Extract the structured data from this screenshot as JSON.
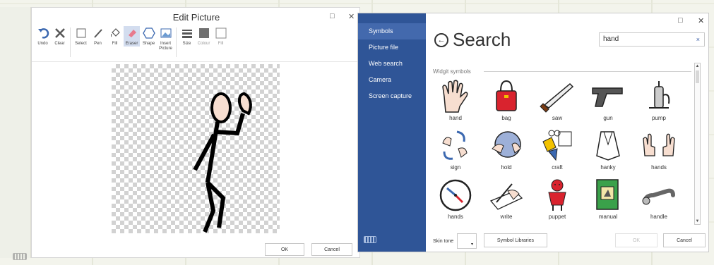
{
  "edit_picture": {
    "title": "Edit Picture",
    "window_buttons": {
      "restore": "□",
      "close": "✕"
    },
    "tools": [
      {
        "label": "Undo",
        "icon": "undo-icon"
      },
      {
        "label": "Clear",
        "icon": "clear-icon"
      },
      {
        "label": "Select",
        "icon": "select-icon"
      },
      {
        "label": "Pen",
        "icon": "pen-icon"
      },
      {
        "label": "Fill",
        "icon": "fill-icon"
      },
      {
        "label": "Eraser",
        "icon": "eraser-icon"
      },
      {
        "label": "Shape",
        "icon": "shape-icon"
      },
      {
        "label": "Insert Picture",
        "icon": "insert-picture-icon"
      },
      {
        "label": "Size",
        "icon": "size-icon"
      },
      {
        "label": "Colour",
        "icon": "colour-icon"
      },
      {
        "label": "Fill",
        "icon": "fill-swatch-icon"
      }
    ],
    "ok_label": "OK",
    "cancel_label": "Cancel"
  },
  "search_panel": {
    "nav": [
      "Symbols",
      "Picture file",
      "Web search",
      "Camera",
      "Screen capture"
    ],
    "active_nav": "Symbols",
    "title": "Search",
    "window_buttons": {
      "restore": "□",
      "close": "✕"
    },
    "query": "hand",
    "clear_glyph": "×",
    "section_header": "Widgit symbols",
    "results": [
      {
        "label": "hand"
      },
      {
        "label": "bag"
      },
      {
        "label": "saw"
      },
      {
        "label": "gun"
      },
      {
        "label": "pump"
      },
      {
        "label": "sign"
      },
      {
        "label": "hold"
      },
      {
        "label": "craft"
      },
      {
        "label": "hanky"
      },
      {
        "label": "hands"
      },
      {
        "label": "hands"
      },
      {
        "label": "write"
      },
      {
        "label": "puppet"
      },
      {
        "label": "manual"
      },
      {
        "label": "handle"
      }
    ],
    "footer": {
      "skin_tone_label": "Skin tone",
      "symbol_libraries_label": "Symbol Libraries",
      "ok_label": "OK",
      "cancel_label": "Cancel"
    },
    "accent": "#2f5597"
  }
}
